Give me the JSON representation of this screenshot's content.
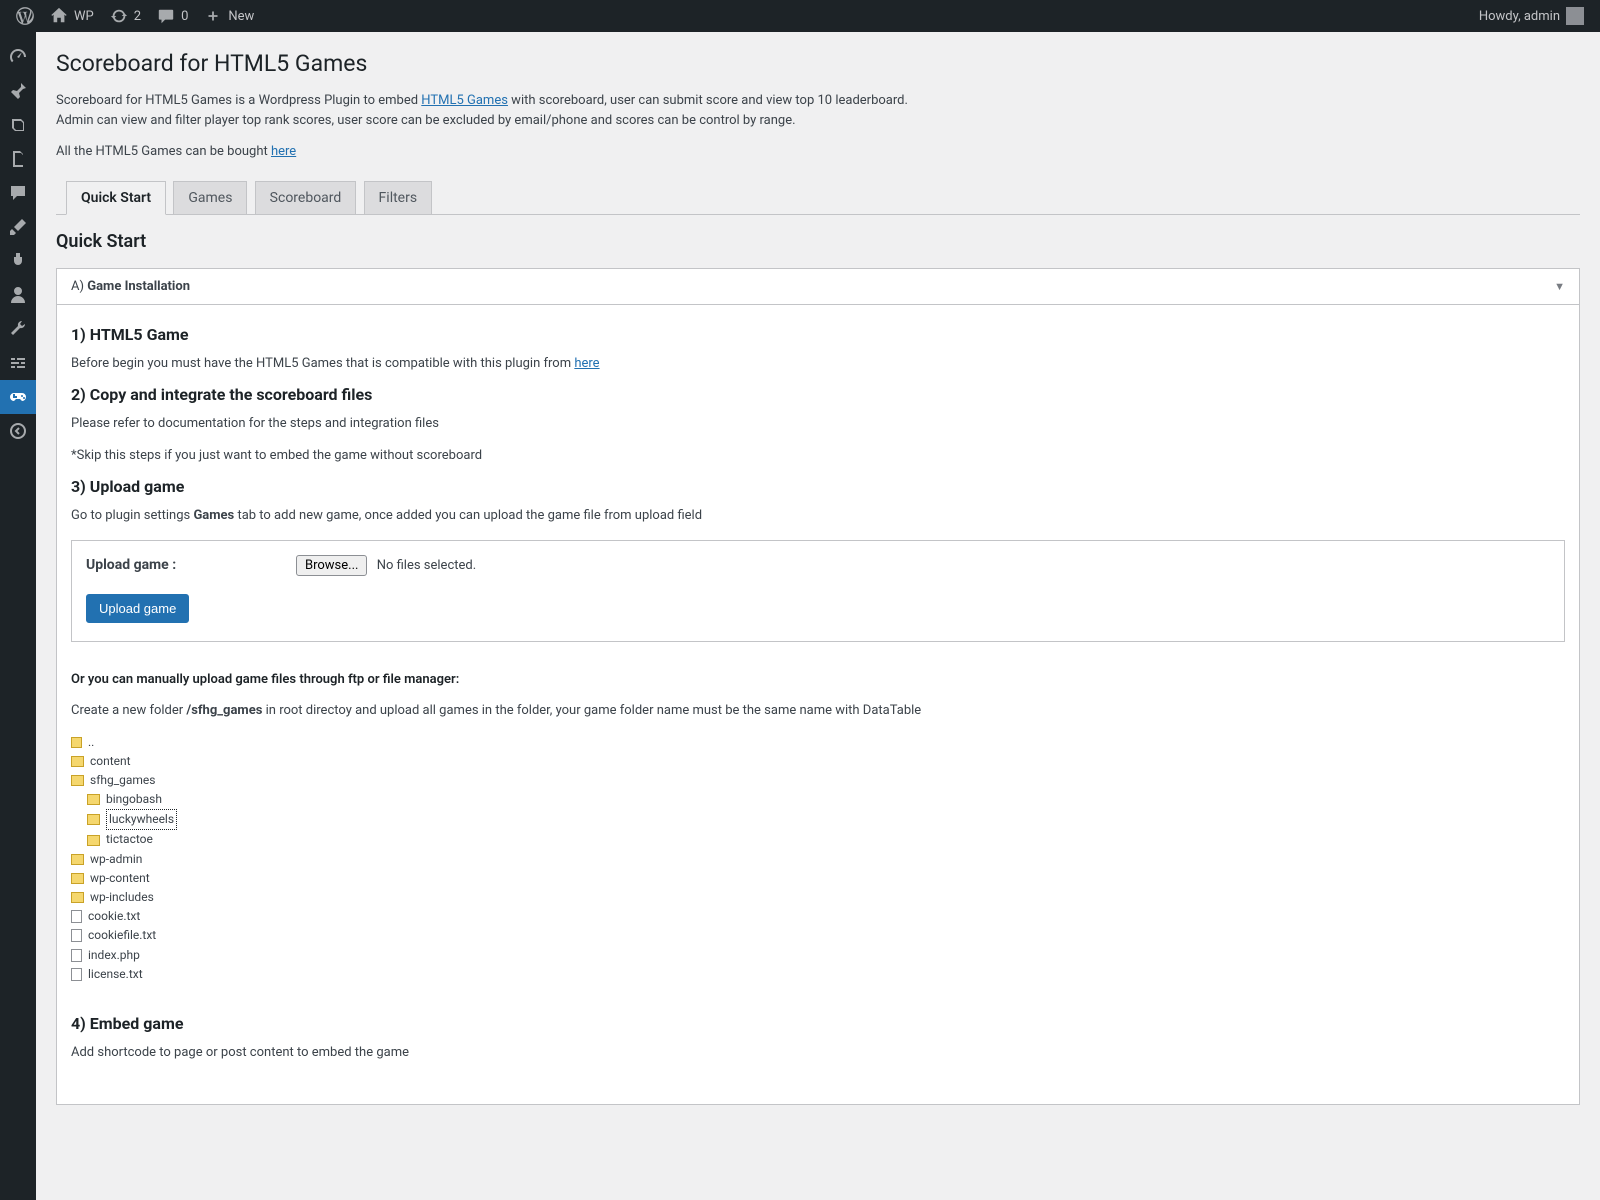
{
  "adminbar": {
    "site_name": "WP",
    "updates_count": "2",
    "comments_count": "0",
    "new_label": "New",
    "greeting": "Howdy, admin"
  },
  "page": {
    "title": "Scoreboard for HTML5 Games",
    "desc1_pre": "Scoreboard for HTML5 Games is a Wordpress Plugin to embed ",
    "desc1_link": "HTML5 Games",
    "desc1_post": " with scoreboard, user can submit score and view top 10 leaderboard.",
    "desc2": "Admin can view and filter player top rank scores, user score can be excluded by email/phone and scores can be control by range.",
    "desc3_pre": "All the HTML5 Games can be bought ",
    "desc3_link": "here"
  },
  "tabs": {
    "quickstart": "Quick Start",
    "games": "Games",
    "scoreboard": "Scoreboard",
    "filters": "Filters"
  },
  "section_title": "Quick Start",
  "accordion": {
    "heading_prefix": "A) ",
    "heading_bold": "Game Installation"
  },
  "steps": {
    "s1_title": "1) HTML5 Game",
    "s1_text_pre": "Before begin you must have the HTML5 Games that is compatible with this plugin from ",
    "s1_link": "here",
    "s2_title": "2) Copy and integrate the scoreboard files",
    "s2_text1": "Please refer to documentation for the steps and integration files",
    "s2_text2": "*Skip this steps if you just want to embed the game without scoreboard",
    "s3_title": "3) Upload game",
    "s3_text_pre": "Go to plugin settings ",
    "s3_text_bold": "Games",
    "s3_text_post": " tab to add new game, once added you can upload the game file from upload field",
    "upload_label": "Upload game :",
    "browse_label": "Browse...",
    "nofiles": "No files selected.",
    "upload_btn": "Upload game",
    "manual_note": "Or you can manually upload game files through ftp or file manager:",
    "create_pre": "Create a new folder ",
    "create_bold": "/sfhg_games",
    "create_post": " in root directoy and upload all games in the folder, your game folder name must be the same name with DataTable",
    "s4_title": "4) Embed game",
    "s4_text": "Add shortcode to page or post content to embed the game"
  },
  "tree": {
    "up": "..",
    "content": "content",
    "sfhg": "sfhg_games",
    "bingo": "bingobash",
    "lucky": "luckywheels",
    "tictactoe": "tictactoe",
    "wpadmin": "wp-admin",
    "wpcontent": "wp-content",
    "wpincludes": "wp-includes",
    "cookie": "cookie.txt",
    "cookiefile": "cookiefile.txt",
    "index": "index.php",
    "license": "license.txt"
  }
}
